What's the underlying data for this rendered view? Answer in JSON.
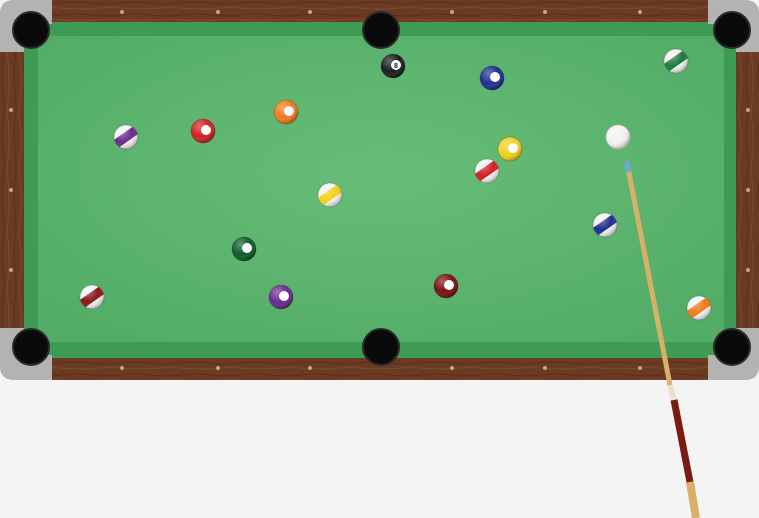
{
  "game": {
    "name": "billiards",
    "table": {
      "felt_color": "#5cb56e",
      "cushion_color": "#3f9a55",
      "rail_color": "#6b3a22",
      "corner_color": "#a9a9a9",
      "pocket_color": "#0a0a0a"
    },
    "cue_ball": {
      "color": "#f2f2f2"
    },
    "cue_stick": {
      "shaft_color": "#d9b06a",
      "butt_color": "#7a1b12",
      "tip_color": "#6fa6d6"
    },
    "balls": [
      {
        "number": "8",
        "color": "#1c1c1c",
        "style": "solid"
      },
      {
        "number": "2",
        "color": "#1f2f8f",
        "style": "solid"
      },
      {
        "number": "14",
        "color": "#1e7a3e",
        "style": "stripe"
      },
      {
        "number": "12",
        "color": "#6a2b8e",
        "style": "stripe"
      },
      {
        "number": "3",
        "color": "#d11f25",
        "style": "solid"
      },
      {
        "number": "5",
        "color": "#f07a1c",
        "style": "solid"
      },
      {
        "number": "1",
        "color": "#f2d11c",
        "style": "solid"
      },
      {
        "number": "11",
        "color": "#d11f25",
        "style": "stripe"
      },
      {
        "number": "9",
        "color": "#f2d11c",
        "style": "stripe"
      },
      {
        "number": "10",
        "color": "#1f2f8f",
        "style": "stripe"
      },
      {
        "number": "6",
        "color": "#0f5a2a",
        "style": "solid"
      },
      {
        "number": "4",
        "color": "#6a2b8e",
        "style": "solid"
      },
      {
        "number": "7",
        "color": "#7a1111",
        "style": "solid"
      },
      {
        "number": "15",
        "color": "#8a1616",
        "style": "stripe"
      },
      {
        "number": "13",
        "color": "#f07a1c",
        "style": "stripe"
      }
    ]
  }
}
